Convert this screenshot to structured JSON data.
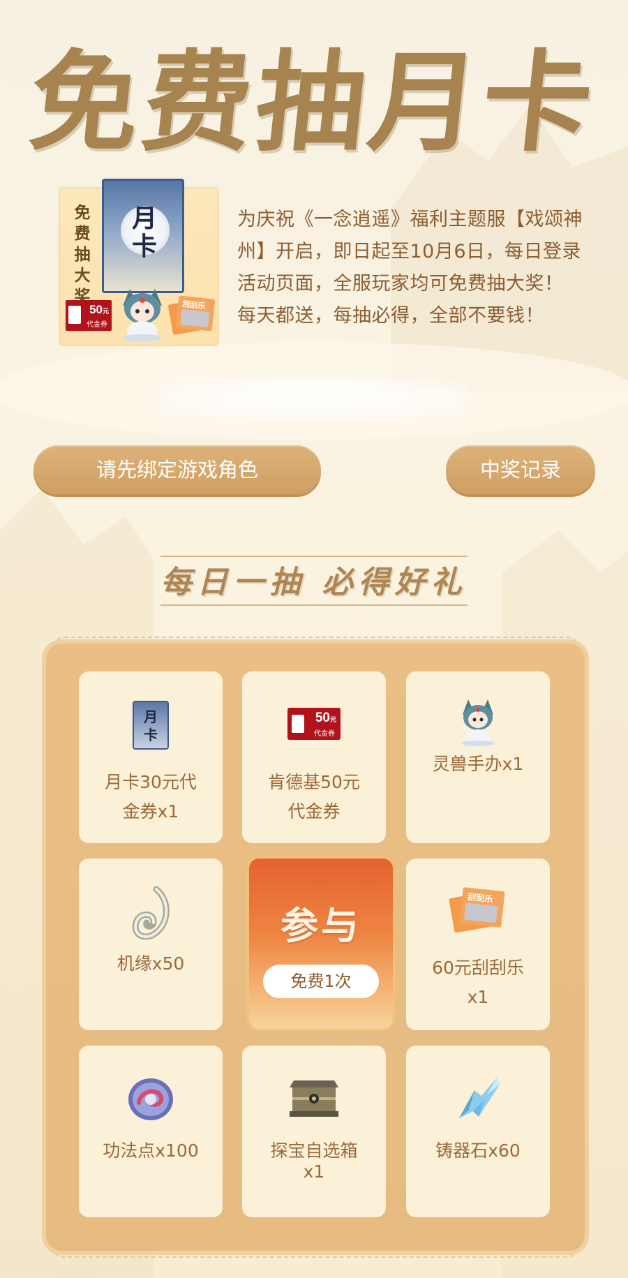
{
  "header": {
    "title": "免费抽月卡"
  },
  "promo": {
    "badge_text": "免费抽大奖",
    "card_glyph": "月卡",
    "coupon_amount": "50",
    "coupon_unit": "元",
    "coupon_label": "代金券",
    "scratch_label": "刮刮乐"
  },
  "description": {
    "line1": "为庆祝《一念逍遥》福利主题服【戏颂神",
    "line2": "州】开启，即日起至10月6日，每日登录",
    "line3": "活动页面，全服玩家均可免费抽大奖！",
    "line4": "每天都送，每抽必得，全部不要钱！"
  },
  "actions": {
    "bind_label": "请先绑定游戏角色",
    "record_label": "中奖记录"
  },
  "section": {
    "subtitle": "每日一抽 必得好礼"
  },
  "draw": {
    "join_label": "参与",
    "free_label": "免费1次"
  },
  "prizes": [
    {
      "line1": "月卡30元代",
      "line2": "金券x1",
      "icon": "month-card-icon"
    },
    {
      "line1": "肯德基50元",
      "line2": "代金券",
      "icon": "kfc-coupon-icon"
    },
    {
      "line1": "灵兽手办x1",
      "line2": "",
      "icon": "spirit-beast-figure-icon"
    },
    {
      "line1": "机缘x50",
      "line2": "",
      "icon": "fortune-swirl-icon"
    },
    {
      "line1": "60元刮刮乐",
      "line2": "x1",
      "icon": "scratch-card-icon"
    },
    {
      "line1": "功法点x100",
      "line2": "",
      "icon": "skill-orb-icon"
    },
    {
      "line1": "探宝自选箱",
      "line2": "x1",
      "icon": "treasure-chest-icon"
    },
    {
      "line1": "铸器石x60",
      "line2": "",
      "icon": "forge-crystal-icon"
    }
  ],
  "colors": {
    "accent": "#d4a468",
    "title": "#a6834f",
    "text": "#8b5e32",
    "panel": "#e8bd83",
    "cell": "#fbf0d8",
    "join": "#e4622f"
  }
}
